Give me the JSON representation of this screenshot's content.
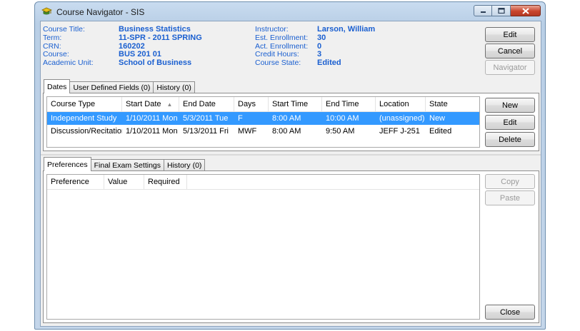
{
  "window": {
    "title": "Course Navigator - SIS"
  },
  "course_info": {
    "left": [
      {
        "label": "Course Title:",
        "value": "Business Statistics"
      },
      {
        "label": "Term:",
        "value": "11-SPR - 2011 SPRING"
      },
      {
        "label": "CRN:",
        "value": "160202"
      },
      {
        "label": "Course:",
        "value": "BUS 201 01"
      },
      {
        "label": "Academic Unit:",
        "value": "School of Business"
      }
    ],
    "right": [
      {
        "label": "Instructor:",
        "value": "Larson, William"
      },
      {
        "label": "Est. Enrollment:",
        "value": "30"
      },
      {
        "label": "Act. Enrollment:",
        "value": "0"
      },
      {
        "label": "Credit Hours:",
        "value": "3"
      },
      {
        "label": "Course State:",
        "value": "Edited"
      }
    ]
  },
  "top_buttons": {
    "edit": "Edit",
    "cancel": "Cancel",
    "navigator": "Navigator"
  },
  "upper_tabs": [
    "Dates",
    "User Defined Fields (0)",
    "History (0)"
  ],
  "dates_grid": {
    "columns": [
      "Course Type",
      "Start Date",
      "End Date",
      "Days",
      "Start Time",
      "End Time",
      "Location",
      "State"
    ],
    "rows": [
      [
        "Independent Study",
        "1/10/2011 Mon",
        "5/3/2011 Tue",
        "F",
        "8:00 AM",
        "10:00 AM",
        "(unassigned)",
        "New"
      ],
      [
        "Discussion/Recitation",
        "1/10/2011 Mon",
        "5/13/2011 Fri",
        "MWF",
        "8:00 AM",
        "9:50 AM",
        "JEFF J-251",
        "Edited"
      ]
    ]
  },
  "dates_buttons": {
    "new": "New",
    "edit": "Edit",
    "delete": "Delete"
  },
  "lower_tabs": [
    "Preferences",
    "Final Exam Settings",
    "History (0)"
  ],
  "preferences_grid": {
    "columns": [
      "Preference",
      "Value",
      "Required"
    ]
  },
  "pref_buttons": {
    "copy": "Copy",
    "paste": "Paste",
    "close": "Close"
  },
  "colors": {
    "label_blue": "#1a5fd0",
    "selection": "#3399ff"
  }
}
